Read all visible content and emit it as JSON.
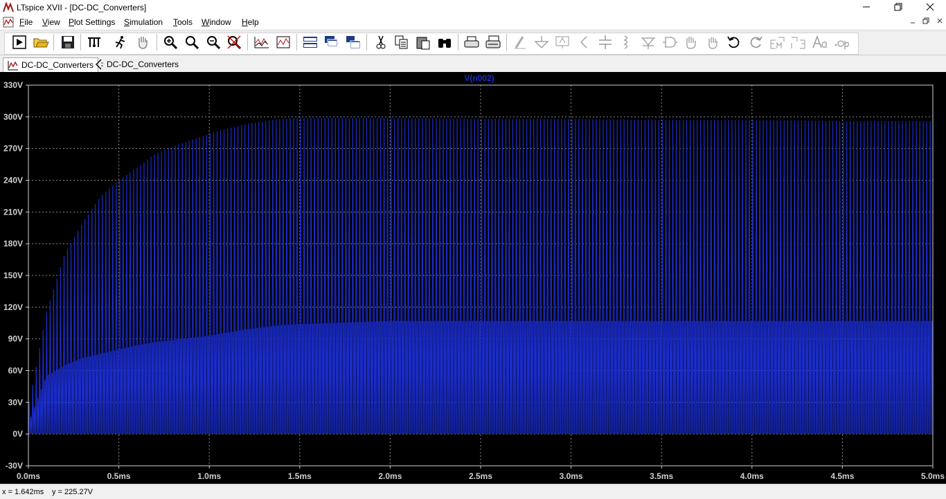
{
  "window": {
    "title": "LTspice XVII - [DC-DC_Converters]",
    "controls": [
      "minimize-icon",
      "restore-icon",
      "close-icon"
    ]
  },
  "menu": {
    "items": [
      {
        "accel": "F",
        "rest": "ile"
      },
      {
        "accel": "V",
        "rest": "iew"
      },
      {
        "accel": "P",
        "rest": "lot Settings"
      },
      {
        "accel": "S",
        "rest": "imulation"
      },
      {
        "accel": "T",
        "rest": "ools"
      },
      {
        "accel": "W",
        "rest": "indow"
      },
      {
        "accel": "H",
        "rest": "elp"
      }
    ],
    "mdi_controls": [
      "minimize-icon",
      "restore-icon",
      "close-icon"
    ]
  },
  "toolbar": {
    "icons": [
      "run-icon",
      "open-icon",
      "save-icon",
      "control-panel-icon",
      "halt-icon",
      "pan-hand-icon",
      "zoom-in-icon",
      "zoom-box-icon",
      "zoom-out-icon",
      "zoom-fit-icon",
      "autorange-icon",
      "add-plot-pane-icon",
      "tile-horizontal-icon",
      "cascade-icon",
      "tile-vertical-icon",
      "cut-icon",
      "copy-icon",
      "paste-icon",
      "find-icon",
      "print-icon",
      "print-setup-icon",
      "wire-icon",
      "ground-icon",
      "label-net-icon",
      "resistor-icon",
      "capacitor-icon",
      "inductor-icon",
      "diode-icon",
      "component-icon",
      "move-icon",
      "drag-icon",
      "undo-icon",
      "redo-icon",
      "rotate-icon",
      "mirror-icon",
      "text-icon",
      "spice-directive-icon"
    ]
  },
  "tabs": [
    {
      "label": "DC-DC_Converters",
      "icon": "waveform-icon",
      "active": true
    },
    {
      "label": "DC-DC_Converters",
      "icon": "schematic-icon",
      "active": false
    }
  ],
  "colors": {
    "plot_background": "#000000",
    "trace": "#1a2cc8",
    "grid": "#8a8a8a"
  },
  "chart_data": {
    "type": "line",
    "series": [
      {
        "name": "V(n002)"
      }
    ],
    "x": [
      0,
      0.1,
      0.2,
      0.3,
      0.4,
      0.5,
      0.6,
      0.7,
      0.8,
      0.9,
      1.0,
      1.1,
      1.2,
      1.3,
      1.4,
      1.5,
      2.0,
      2.5,
      3.0,
      3.5,
      4.0,
      4.5,
      5.0
    ],
    "envelope_max": [
      25,
      115,
      170,
      200,
      225,
      240,
      252,
      265,
      272,
      278,
      284,
      289,
      293,
      296,
      298,
      299,
      299,
      298,
      298,
      297,
      297,
      296,
      296
    ],
    "envelope_upper_cluster": [
      10,
      55,
      65,
      72,
      76,
      80,
      84,
      87,
      89,
      91,
      93,
      96,
      99,
      101,
      103,
      104,
      107,
      107,
      107,
      107,
      107,
      107,
      107
    ],
    "envelope_min": [
      0,
      0,
      0,
      0,
      0,
      0,
      0,
      0,
      0,
      0,
      0,
      0,
      0,
      0,
      0,
      0,
      0,
      0,
      0,
      0,
      0,
      0,
      0
    ],
    "xlim": [
      0,
      5.0
    ],
    "ylim": [
      -30,
      330
    ],
    "x_ticks": [
      "0.0ms",
      "0.5ms",
      "1.0ms",
      "1.5ms",
      "2.0ms",
      "2.5ms",
      "3.0ms",
      "3.5ms",
      "4.0ms",
      "4.5ms",
      "5.0ms"
    ],
    "x_tick_values": [
      0,
      0.5,
      1.0,
      1.5,
      2.0,
      2.5,
      3.0,
      3.5,
      4.0,
      4.5,
      5.0
    ],
    "y_ticks": [
      "330V",
      "300V",
      "270V",
      "240V",
      "210V",
      "180V",
      "150V",
      "120V",
      "90V",
      "60V",
      "30V",
      "0V",
      "-30V"
    ],
    "y_tick_values": [
      330,
      300,
      270,
      240,
      210,
      180,
      150,
      120,
      90,
      60,
      30,
      0,
      -30
    ],
    "trace_label": "V(n002)",
    "grid": true
  },
  "status": {
    "x": "x = 1.642ms",
    "y": "y = 225.27V"
  }
}
